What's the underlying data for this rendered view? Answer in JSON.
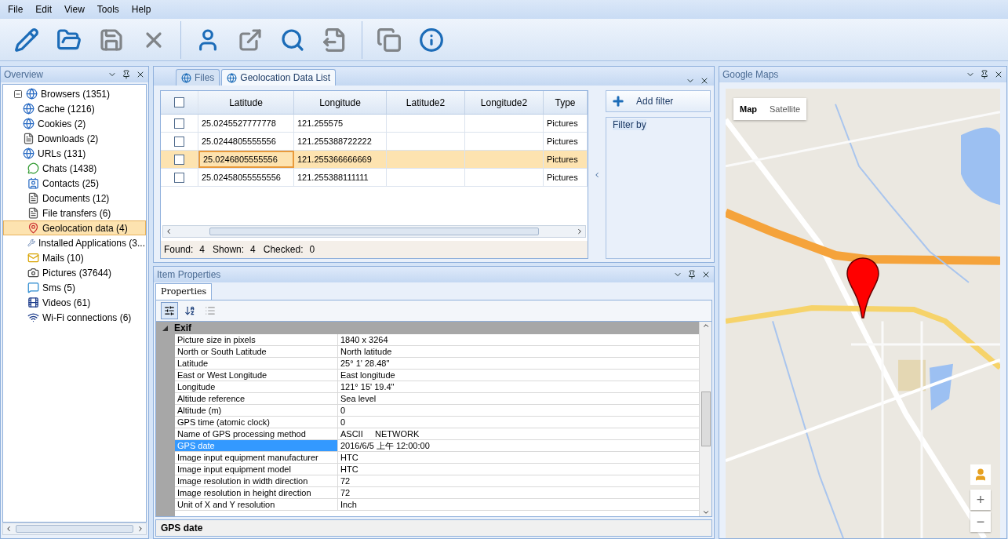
{
  "menu": [
    {
      "label": "File"
    },
    {
      "label": "Edit"
    },
    {
      "label": "View"
    },
    {
      "label": "Tools"
    },
    {
      "label": "Help"
    }
  ],
  "toolbar": [
    {
      "kind": "edit"
    },
    {
      "kind": "open"
    },
    {
      "kind": "save",
      "disabled": true
    },
    {
      "kind": "delete",
      "disabled": true
    },
    {
      "kind": "sep"
    },
    {
      "kind": "user"
    },
    {
      "kind": "export",
      "disabled": true
    },
    {
      "kind": "search"
    },
    {
      "kind": "report",
      "disabled": true
    },
    {
      "kind": "sep"
    },
    {
      "kind": "copy",
      "disabled": true
    },
    {
      "kind": "info"
    }
  ],
  "overview": {
    "title": "Overview",
    "items": [
      {
        "label": "Browsers (1351)",
        "kind": "globe",
        "selected": false,
        "expanded": true,
        "children": [
          {
            "label": "Cache (1216)",
            "kind": "globe",
            "selected": false
          },
          {
            "label": "Cookies (2)",
            "kind": "globe",
            "selected": false
          },
          {
            "label": "Downloads (2)",
            "kind": "doc",
            "selected": false
          },
          {
            "label": "URLs (131)",
            "kind": "globe",
            "selected": false
          }
        ]
      },
      {
        "label": "Chats (1438)",
        "kind": "chat",
        "selected": false
      },
      {
        "label": "Contacts (25)",
        "kind": "contact",
        "selected": false
      },
      {
        "label": "Documents (12)",
        "kind": "doc",
        "selected": false
      },
      {
        "label": "File transfers (6)",
        "kind": "doc",
        "selected": false
      },
      {
        "label": "Geolocation data (4)",
        "kind": "geo",
        "selected": true
      },
      {
        "label": "Installed Applications (3...",
        "kind": "wrench",
        "selected": false
      },
      {
        "label": "Mails (10)",
        "kind": "mail",
        "selected": false
      },
      {
        "label": "Pictures (37644)",
        "kind": "camera",
        "selected": false
      },
      {
        "label": "Sms (5)",
        "kind": "sms",
        "selected": false
      },
      {
        "label": "Videos (61)",
        "kind": "video",
        "selected": false
      },
      {
        "label": "Wi-Fi connections (6)",
        "kind": "wifi",
        "selected": false
      }
    ]
  },
  "list": {
    "tabs": [
      {
        "label": "Files",
        "selected": false
      },
      {
        "label": "Geolocation Data List",
        "selected": true
      }
    ],
    "header_checked": false,
    "columns": [
      "Latitude",
      "Longitude",
      "Latitude2",
      "Longitude2",
      "Type"
    ],
    "rows": [
      {
        "checked": false,
        "selected": false,
        "cells": [
          "25.0245527777778",
          "121.255575",
          "",
          "",
          "Pictures"
        ]
      },
      {
        "checked": false,
        "selected": false,
        "cells": [
          "25.0244805555556",
          "121.255388722222",
          "",
          "",
          "Pictures"
        ]
      },
      {
        "checked": false,
        "selected": true,
        "cells": [
          "25.0246805555556",
          "121.255366666669",
          "",
          "",
          "Pictures"
        ]
      },
      {
        "checked": false,
        "selected": false,
        "cells": [
          "25.02458055555556",
          "121.255388111111",
          "",
          "",
          "Pictures"
        ]
      }
    ],
    "status": [
      {
        "label": "Found:",
        "value": "4"
      },
      {
        "label": "Shown:",
        "value": "4"
      },
      {
        "label": "Checked:",
        "value": "0"
      }
    ],
    "add_filter": "Add filter",
    "filter_by": "Filter by"
  },
  "properties": {
    "title": "Item Properties",
    "tab": "Properties",
    "group": "Exif",
    "rows": [
      {
        "name": "Picture size in pixels",
        "value": "1840 x 3264",
        "selected": false
      },
      {
        "name": "North or South Latitude",
        "value": "North latitude",
        "selected": false
      },
      {
        "name": "Latitude",
        "value": "25° 1' 28.48\"",
        "selected": false
      },
      {
        "name": "East or West Longitude",
        "value": "East longitude",
        "selected": false
      },
      {
        "name": "Longitude",
        "value": "121° 15' 19.4\"",
        "selected": false
      },
      {
        "name": "Altitude reference",
        "value": "Sea level",
        "selected": false
      },
      {
        "name": "Altitude (m)",
        "value": "0",
        "selected": false
      },
      {
        "name": "GPS time (atomic clock)",
        "value": "0",
        "selected": false
      },
      {
        "name": "Name of GPS processing method",
        "value": "ASCII     NETWORK",
        "selected": false
      },
      {
        "name": "GPS date",
        "value": "2016/6/5 上午 12:00:00",
        "selected": true
      },
      {
        "name": "Image input equipment manufacturer",
        "value": "HTC",
        "selected": false
      },
      {
        "name": "Image input equipment model",
        "value": "HTC",
        "selected": false
      },
      {
        "name": "Image resolution in width direction",
        "value": "72",
        "selected": false
      },
      {
        "name": "Image resolution in height direction",
        "value": "72",
        "selected": false
      },
      {
        "name": "Unit of X and Y resolution",
        "value": "Inch",
        "selected": false
      }
    ],
    "description": "GPS date"
  },
  "map": {
    "title": "Google Maps",
    "types": [
      {
        "label": "Map",
        "selected": true
      },
      {
        "label": "Satellite",
        "selected": false
      }
    ],
    "zoom_in": "+",
    "zoom_out": "−"
  }
}
